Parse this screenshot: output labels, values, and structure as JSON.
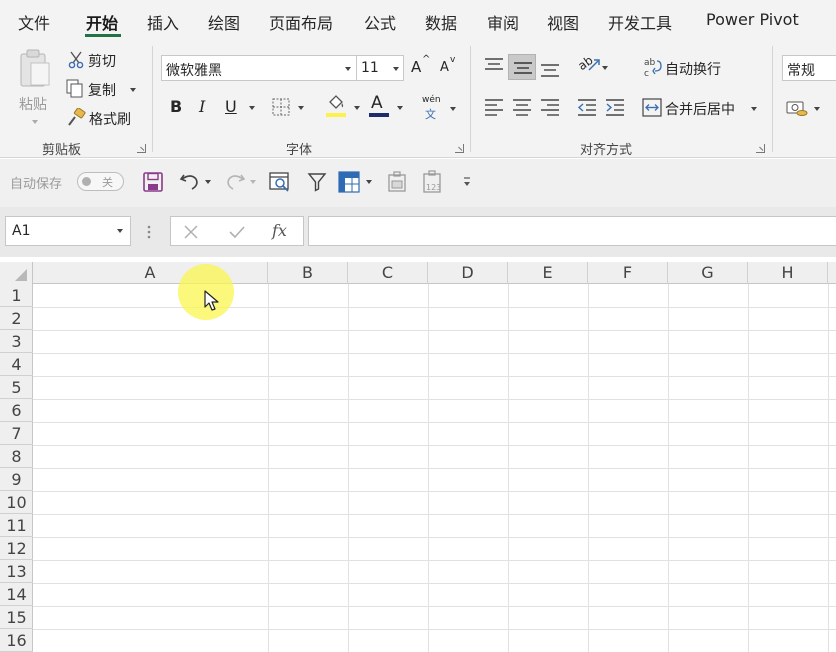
{
  "tabs": [
    {
      "label": "文件",
      "active": false
    },
    {
      "label": "开始",
      "active": true
    },
    {
      "label": "插入",
      "active": false
    },
    {
      "label": "绘图",
      "active": false
    },
    {
      "label": "页面布局",
      "active": false
    },
    {
      "label": "公式",
      "active": false
    },
    {
      "label": "数据",
      "active": false
    },
    {
      "label": "审阅",
      "active": false
    },
    {
      "label": "视图",
      "active": false
    },
    {
      "label": "开发工具",
      "active": false
    },
    {
      "label": "Power Pivot",
      "active": false
    }
  ],
  "clipboard": {
    "paste_label": "粘贴",
    "cut_label": "剪切",
    "copy_label": "复制",
    "format_painter_label": "格式刷",
    "group_label": "剪贴板"
  },
  "font": {
    "family": "微软雅黑",
    "size": "11",
    "bold_label": "B",
    "italic_label": "I",
    "underline_label": "U",
    "font_color_label": "A",
    "phonetic_top": "wén",
    "phonetic_bottom": "文",
    "grow_label": "A",
    "shrink_label": "A",
    "group_label": "字体"
  },
  "alignment": {
    "wrap_text_label": "自动换行",
    "merge_center_label": "合并后居中",
    "group_label": "对齐方式",
    "orientation_label": "ab"
  },
  "number": {
    "format_value": "常规"
  },
  "qat": {
    "autosave_label": "自动保存",
    "toggle_label": "关"
  },
  "formula_bar": {
    "name_box": "A1",
    "fx_label": "fx"
  },
  "grid": {
    "columns": [
      "A",
      "B",
      "C",
      "D",
      "E",
      "F",
      "G",
      "H"
    ],
    "rows": [
      "1",
      "2",
      "3",
      "4",
      "5",
      "6",
      "7",
      "8",
      "9",
      "10",
      "11",
      "12",
      "13",
      "14",
      "15",
      "16"
    ]
  },
  "colors": {
    "accent": "#217346",
    "highlight": "#f9f54f",
    "font_color_bar": "#1f2c6b",
    "fill_color_bar": "#fff14d",
    "save_icon": "#8a3a8a"
  }
}
